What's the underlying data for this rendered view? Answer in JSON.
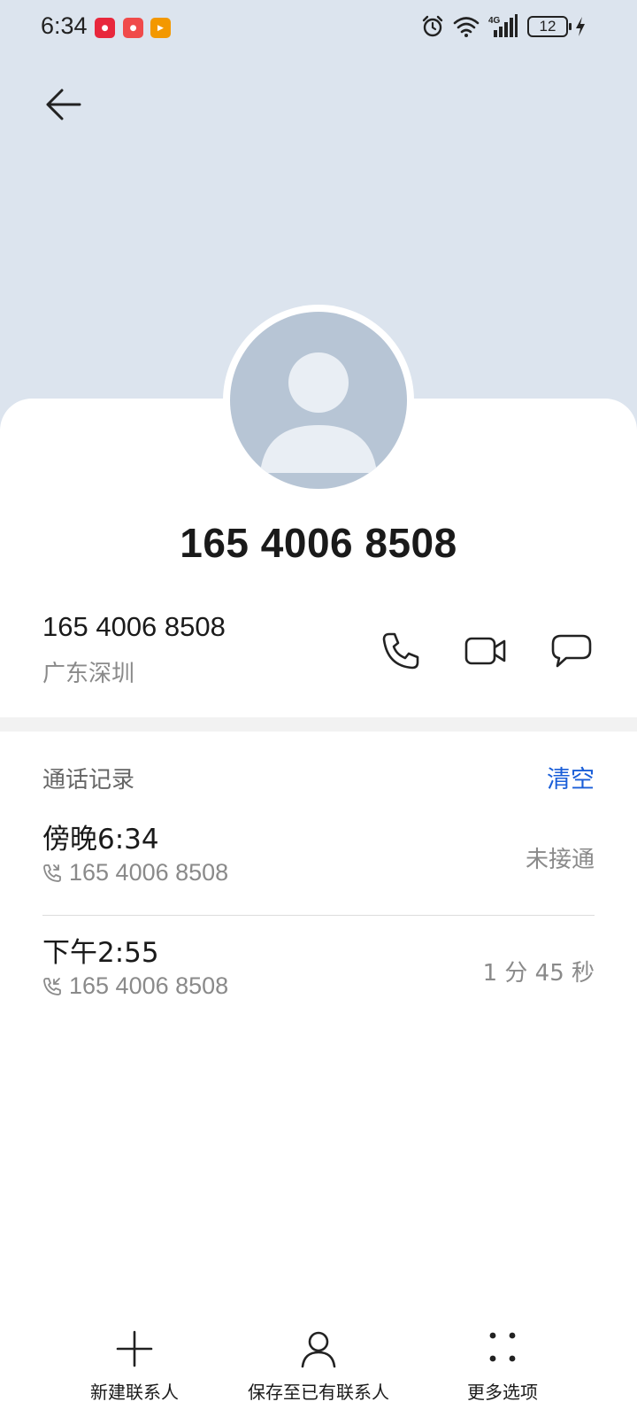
{
  "status_bar": {
    "time": "6:34",
    "battery": "12",
    "network": "4G",
    "notifications": [
      "app-notification-1",
      "app-notification-2",
      "app-notification-3"
    ]
  },
  "contact": {
    "title": "165 4006 8508",
    "phone_number": "165 4006 8508",
    "location": "广东深圳"
  },
  "call_log": {
    "header": "通话记录",
    "clear_label": "清空",
    "items": [
      {
        "time": "傍晚6:34",
        "number": "165 4006 8508",
        "status": "未接通"
      },
      {
        "time": "下午2:55",
        "number": "165 4006 8508",
        "status": "1 分 45 秒"
      }
    ]
  },
  "bottom_actions": [
    {
      "label": "新建联系人",
      "icon": "plus-icon"
    },
    {
      "label": "保存至已有联系人",
      "icon": "person-icon"
    },
    {
      "label": "更多选项",
      "icon": "more-dots-icon"
    }
  ],
  "colors": {
    "header_bg": "#dce4ee",
    "avatar_bg": "#b7c5d5",
    "accent": "#1a5ed8",
    "secondary_text": "#8a8a8a"
  }
}
